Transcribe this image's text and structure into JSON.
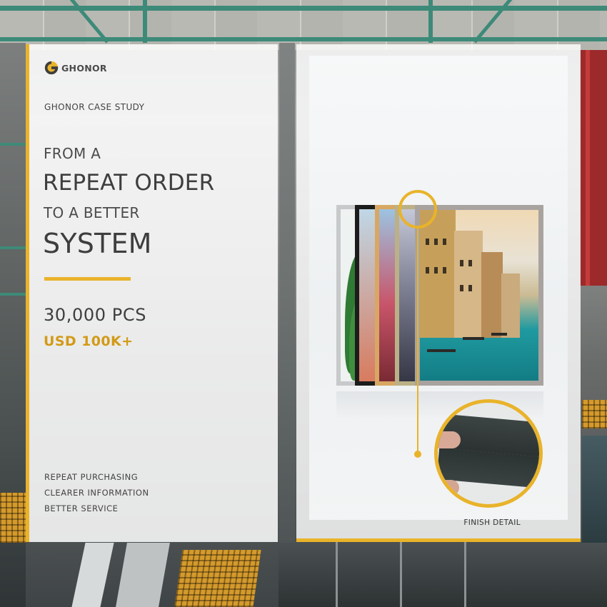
{
  "brand": {
    "name": "GHONOR",
    "logo_icon": "ghonor-logo-icon"
  },
  "eyebrow": "GHONOR CASE STUDY",
  "headline": {
    "line1": "FROM A",
    "line2": "REPEAT ORDER",
    "line3": "TO A BETTER",
    "line4": "SYSTEM"
  },
  "stats": {
    "quantity": "30,000 PCS",
    "value": "USD 100K+"
  },
  "benefits": [
    "REPEAT PURCHASING",
    "CLEARER INFORMATION",
    "BETTER SERVICE"
  ],
  "product": {
    "detail_caption": "FINISH DETAIL"
  },
  "colors": {
    "accent": "#e9b32a",
    "value_text": "#d39a17",
    "text_dark": "#3e3e3e"
  }
}
